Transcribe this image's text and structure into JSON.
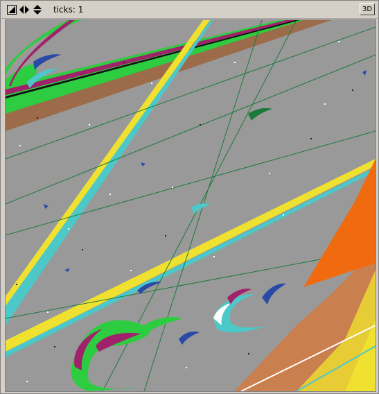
{
  "toolbar": {
    "ticks_label": "ticks: 1",
    "view3d_label": "3D",
    "icons": [
      "zoom-fit-icon",
      "pan-horizontal-icon",
      "pan-vertical-icon"
    ]
  },
  "colors": {
    "background": "#999999",
    "green": "#2ecc40",
    "magenta": "#a0226a",
    "brown": "#9c6b4a",
    "yellow": "#f0e030",
    "cyan": "#4cc8c8",
    "orange": "#f06a10",
    "blue": "#2a4aa8",
    "dark_green": "#1a7a3a"
  }
}
